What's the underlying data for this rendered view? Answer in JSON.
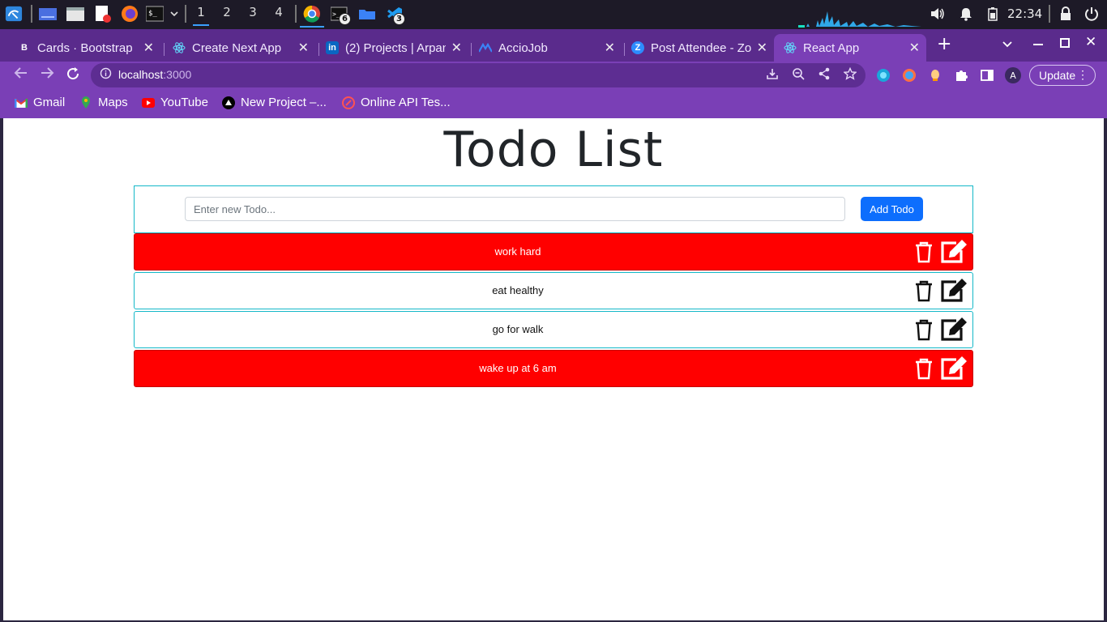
{
  "taskbar": {
    "workspaces": [
      "1",
      "2",
      "3",
      "4"
    ],
    "badges": [
      "6",
      "3"
    ],
    "clock": "22:34"
  },
  "browser": {
    "tabs": [
      {
        "label": "Cards · Bootstrap",
        "favicon": "B",
        "icon": "bootstrap-icon"
      },
      {
        "label": "Create Next App",
        "icon": "react-icon"
      },
      {
        "label": "(2) Projects | Arpan",
        "favicon": "in",
        "icon": "linkedin-icon"
      },
      {
        "label": "AccioJob",
        "icon": "acciojob-icon"
      },
      {
        "label": "Post Attendee - Zo",
        "favicon": "Z",
        "icon": "zoom-icon"
      },
      {
        "label": "React App",
        "icon": "react-icon",
        "active": true
      }
    ],
    "url": "localhost",
    "url_port": ":3000",
    "update_label": "Update",
    "profile_initial": "A",
    "bookmarks": [
      {
        "label": "Gmail",
        "icon": "gmail-icon"
      },
      {
        "label": "Maps",
        "icon": "maps-icon"
      },
      {
        "label": "YouTube",
        "icon": "youtube-icon"
      },
      {
        "label": "New Project –...",
        "icon": "vercel-icon"
      },
      {
        "label": "Online API Tes...",
        "icon": "api-tester-icon"
      }
    ]
  },
  "app": {
    "title": "Todo List",
    "input_placeholder": "Enter new Todo...",
    "add_button": "Add Todo",
    "todos": [
      {
        "text": "work hard",
        "completed": true
      },
      {
        "text": "eat healthy",
        "completed": false
      },
      {
        "text": "go for walk",
        "completed": false
      },
      {
        "text": "wake up at 6 am",
        "completed": true
      }
    ]
  },
  "colors": {
    "completed_bg": "#ff0000",
    "border_accent": "#14b8c8",
    "button_primary": "#0d6efd",
    "browser_theme": "#7a3fb6"
  }
}
